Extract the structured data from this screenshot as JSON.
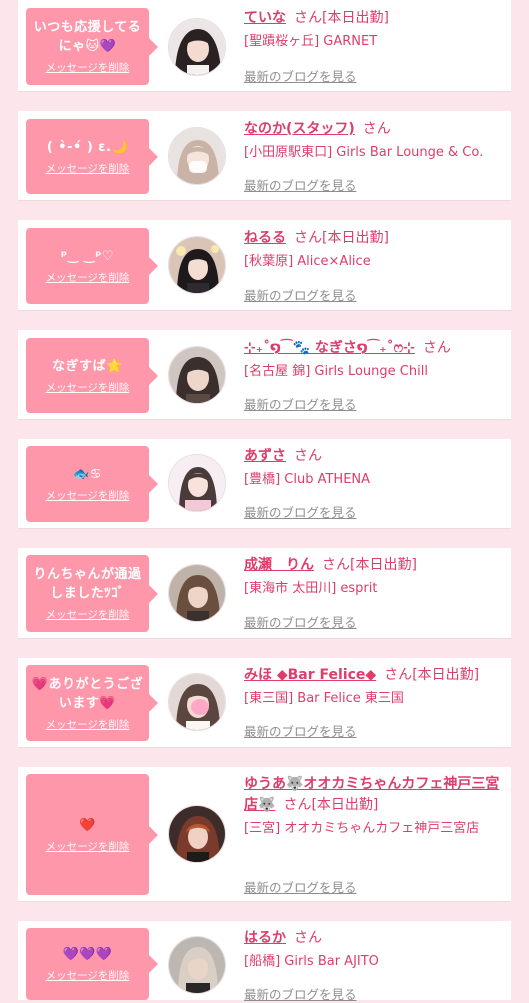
{
  "common": {
    "delete_label": "メッセージを削除",
    "san": "さん",
    "blog_label": "最新のブログを見る",
    "today_badge": "[本日出勤]"
  },
  "cards": [
    {
      "message": "いつも応援してるにゃ🐱💜",
      "name": "ていな",
      "today": "[本日出勤]",
      "shop": "[聖蹟桜ヶ丘] GARNET"
    },
    {
      "message": "( •̀-•́ ) ε.🌙",
      "name": "なのか(スタッフ)",
      "today": "",
      "shop": "[小田原駅東口] Girls Bar Lounge & Co."
    },
    {
      "message": "ᵖ‿ ‿ᵖ♡",
      "name": "ねるる",
      "today": "[本日出勤]",
      "shop": "[秋葉原] Alice×Alice"
    },
    {
      "message": "なぎすば🌟",
      "name": "⊹₊˚໑⁀🐾 なぎさ໑⁀₊˚ෆ⊹",
      "today": "",
      "shop": "[名古屋 錦] Girls Lounge Chill"
    },
    {
      "message": "🐟♋",
      "name": "あずさ",
      "today": "",
      "shop": "[豊橋] Club ATHENA"
    },
    {
      "message": "りんちゃんが通過しましたﾂｺﾞ",
      "name": "成瀬　りん",
      "today": "[本日出勤]",
      "shop": "[東海市 太田川] esprit"
    },
    {
      "message": "💗ありがとうございます💗",
      "name": "みほ ◆Bar Felice◆",
      "today": "[本日出勤]",
      "shop": "[東三国] Bar Felice 東三国"
    },
    {
      "message": "❤️",
      "name": "ゆうあ🐺オオカミちゃんカフェ神戸三宮店🐺",
      "today": "[本日出勤]",
      "shop": "[三宮] オオカミちゃんカフェ神戸三宮店"
    },
    {
      "message": "💜💜💜",
      "name": "はるか",
      "today": "",
      "shop": "[船橋] Girls Bar AJITO"
    }
  ]
}
